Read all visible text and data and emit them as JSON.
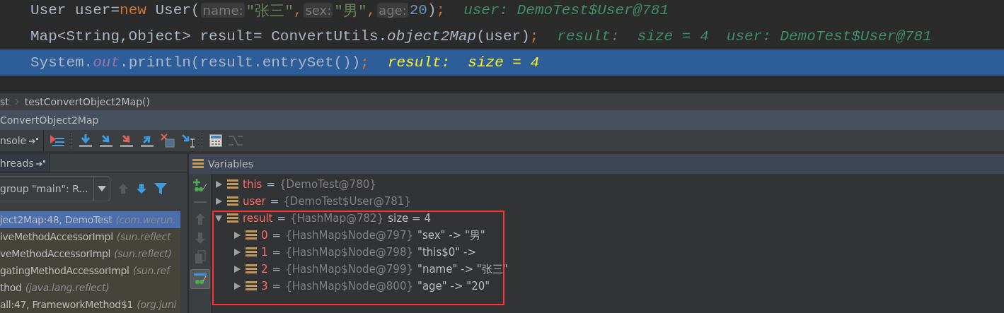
{
  "code_lines": [
    {
      "selected": false,
      "tokens": [
        {
          "kind": "plain",
          "text": "User user="
        },
        {
          "kind": "keyword",
          "text": "new"
        },
        {
          "kind": "plain",
          "text": " User("
        },
        {
          "kind": "hint",
          "text": "name:"
        },
        {
          "kind": "string",
          "text": "\"张三\""
        },
        {
          "kind": "keyword",
          "text": ","
        },
        {
          "kind": "hint",
          "text": "sex:"
        },
        {
          "kind": "string",
          "text": "\"男\""
        },
        {
          "kind": "keyword",
          "text": ","
        },
        {
          "kind": "hint",
          "text": "age:"
        },
        {
          "kind": "number",
          "text": "20"
        },
        {
          "kind": "plain",
          "text": ")"
        },
        {
          "kind": "keyword",
          "text": ";"
        },
        {
          "kind": "inline",
          "text": "user: DemoTest$User@781"
        }
      ]
    },
    {
      "selected": false,
      "tokens": [
        {
          "kind": "plain",
          "text": "Map<String,Object> result= ConvertUtils."
        },
        {
          "kind": "italic",
          "text": "object2Map"
        },
        {
          "kind": "plain",
          "text": "(user)"
        },
        {
          "kind": "keyword",
          "text": ";"
        },
        {
          "kind": "inline",
          "text": "result:  size = 4  user: DemoTest$User@781"
        }
      ]
    },
    {
      "selected": true,
      "tokens": [
        {
          "kind": "plain",
          "text": "System."
        },
        {
          "kind": "static",
          "text": "out"
        },
        {
          "kind": "plain",
          "text": ".println(result.entrySet())"
        },
        {
          "kind": "keyword",
          "text": ";"
        },
        {
          "kind": "inline",
          "text": "result:  size = 4"
        }
      ]
    }
  ],
  "breadcrumb": [
    "st",
    "testConvertObject2Map()"
  ],
  "debug_tab": {
    "title": "ConvertObject2Map"
  },
  "console_tab": {
    "label": "nsole"
  },
  "threads_tab": {
    "label": "hreads"
  },
  "thread_dropdown": {
    "value": "group \"main\": R..."
  },
  "frames": [
    {
      "method": "ject2Map:48, DemoTest",
      "location": "(com.werun.",
      "selected": true
    },
    {
      "method": "iveMethodAccessorImpl",
      "location": "(sun.reflect",
      "selected": false
    },
    {
      "method": "veMethodAccessorImpl",
      "location": "(sun.reflect)",
      "selected": false
    },
    {
      "method": "gatingMethodAccessorImpl",
      "location": "(sun.ref",
      "selected": false
    },
    {
      "method": "thod",
      "location": "(java.lang.reflect)",
      "selected": false
    },
    {
      "method": "all:47, FrameworkMethod$1",
      "location": "(org.juni",
      "selected": false
    }
  ],
  "inline_watches": {
    "on": true
  },
  "variables": {
    "title": "Variables",
    "items": [
      {
        "name": "this",
        "op": "=",
        "value": "{DemoTest@780}",
        "expanded": false
      },
      {
        "name": "user",
        "op": "=",
        "value": "{DemoTest$User@781}",
        "expanded": false
      },
      {
        "name": "result",
        "op": "=",
        "value": "{HashMap@782}",
        "extra": "size = 4",
        "expanded": true,
        "children": [
          {
            "name": "0",
            "op": "=",
            "value": "{HashMap$Node@797}",
            "extra": "\"sex\" -> \"男\"",
            "expanded": false
          },
          {
            "name": "1",
            "op": "=",
            "value": "{HashMap$Node@798}",
            "extra": "\"this$0\" ->",
            "expanded": false
          },
          {
            "name": "2",
            "op": "=",
            "value": "{HashMap$Node@799}",
            "extra": "\"name\" -> \"张三\"",
            "expanded": false
          },
          {
            "name": "3",
            "op": "=",
            "value": "{HashMap$Node@800}",
            "extra": "\"age\" -> \"20\"",
            "expanded": false
          }
        ]
      }
    ]
  }
}
